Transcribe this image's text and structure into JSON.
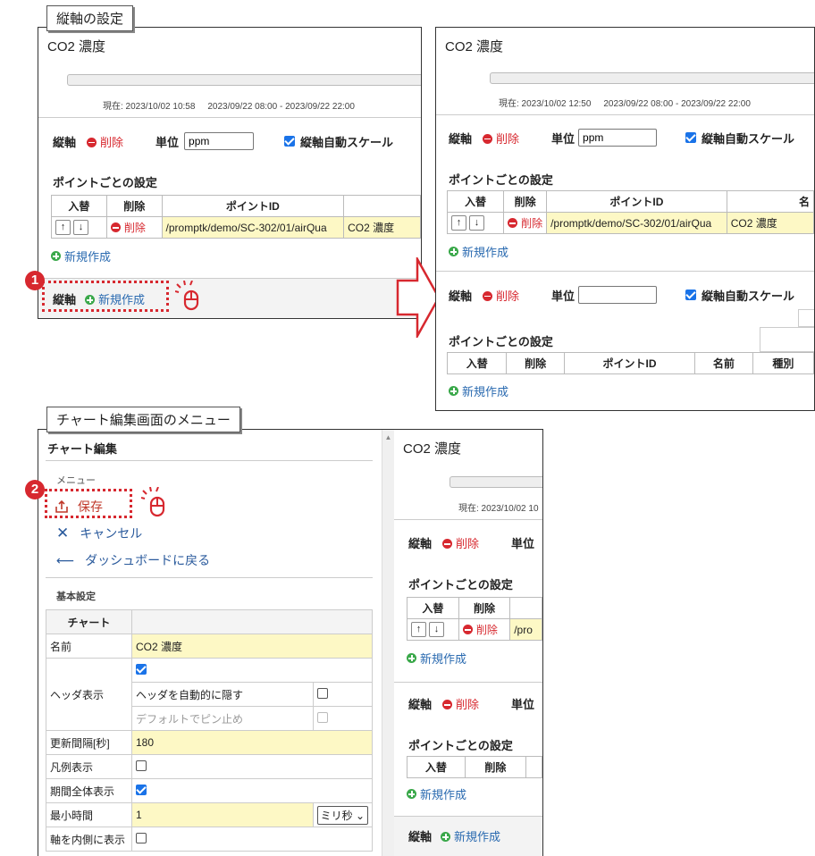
{
  "callouts": {
    "axis": "縦軸の設定",
    "menu": "チャート編集画面のメニュー"
  },
  "steps": {
    "one": "1",
    "two": "2"
  },
  "common": {
    "axis_label": "縦軸",
    "delete": "削除",
    "new": "新規作成",
    "unit_label": "単位",
    "auto_scale": "縦軸自動スケール",
    "points_setting": "ポイントごとの設定",
    "th_swap": "入替",
    "th_delete": "削除",
    "th_point_id": "ポイントID",
    "th_name": "名前",
    "th_type": "種別",
    "point_id_value": "/promptk/demo/SC-302/01/airQua",
    "point_name_value": "CO2 濃度",
    "up_arrow": "↑",
    "down_arrow": "↓"
  },
  "left_top": {
    "chart_title": "CO2 濃度",
    "now": "現在: 2023/10/02 10:58",
    "range": "2023/09/22 08:00 - 2023/09/22 22:00",
    "unit_value": "ppm"
  },
  "right_top": {
    "chart_title": "CO2 濃度",
    "now": "現在: 2023/10/02 12:50",
    "range": "2023/09/22 08:00 - 2023/09/22 22:00",
    "unit_value": "ppm",
    "unit_value_2": "",
    "th_name_partial": "名"
  },
  "editor": {
    "title": "チャート編集",
    "menu_heading": "メニュー",
    "save": "保存",
    "cancel": "キャンセル",
    "back": "ダッシュボードに戻る",
    "basic_settings": "基本設定",
    "chart_header": "チャート",
    "rows": {
      "name_label": "名前",
      "name_value": "CO2 濃度",
      "header_label": "ヘッダ表示",
      "auto_hide": "ヘッダを自動的に隠す",
      "default_pin": "デフォルトでピン止め",
      "interval_label": "更新間隔[秒]",
      "interval_value": "180",
      "legend_label": "凡例表示",
      "whole_label": "期間全体表示",
      "min_time_label": "最小時間",
      "min_time_value": "1",
      "min_time_unit": "ミリ秒",
      "inner_axis_label": "軸を内側に表示"
    }
  },
  "preview": {
    "chart_title": "CO2 濃度",
    "now": "現在: 2023/10/02 10",
    "point_id_partial": "/pro"
  }
}
